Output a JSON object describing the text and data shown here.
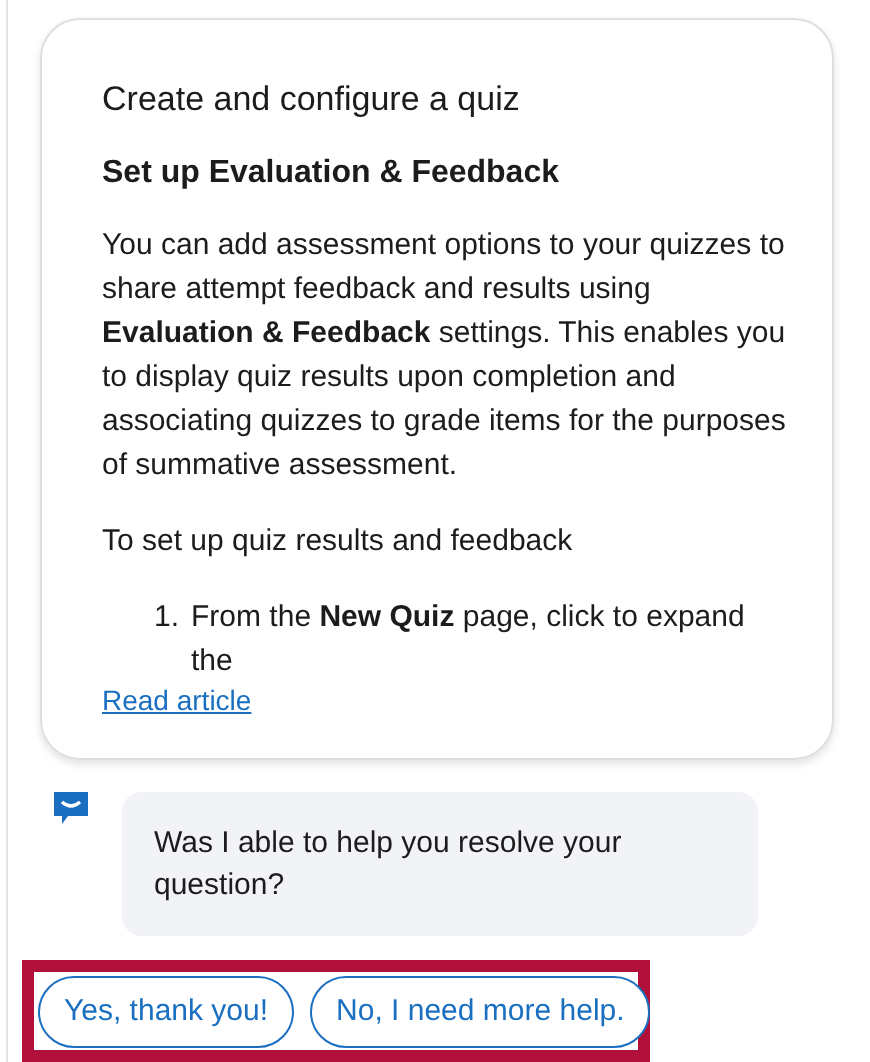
{
  "article": {
    "title": "Create and configure a quiz",
    "heading": "Set up Evaluation & Feedback",
    "paragraphs": [
      "You can add assessment options to your quizzes to share attempt feedback and results using **Evaluation & Feedback** settings. This enables you to display quiz results upon completion and associating quizzes to grade items for the purposes of summative assessment.",
      "To set up quiz results and feedback"
    ],
    "steps": [
      {
        "number": "1.",
        "text": "From the **New Quiz** page, click to expand the"
      }
    ],
    "link": "Read article"
  },
  "message": {
    "text": "Was I able to help you resolve your question?"
  },
  "replies": [
    {
      "label": "Yes, thank you!"
    },
    {
      "label": "No, I need more help."
    }
  ]
}
